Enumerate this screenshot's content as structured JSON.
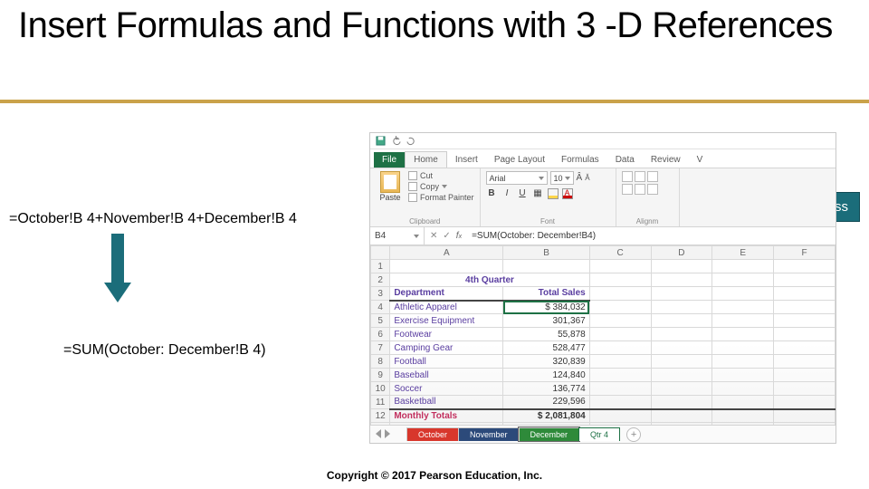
{
  "title": "Insert Formulas and Functions with 3 -D References",
  "left": {
    "formula_long": "=October!B 4+November!B 4+December!B 4",
    "formula_short": "=SUM(October: December!B 4)"
  },
  "callout": {
    "label": "Cell address"
  },
  "excel": {
    "ribbon": {
      "tabs": [
        "File",
        "Home",
        "Insert",
        "Page Layout",
        "Formulas",
        "Data",
        "Review",
        "V"
      ],
      "clipboard": {
        "paste": "Paste",
        "cut": "Cut",
        "copy": "Copy",
        "painter": "Format Painter",
        "group": "Clipboard"
      },
      "font": {
        "name": "Arial",
        "size": "10",
        "group": "Font"
      },
      "align": {
        "group": "Alignm"
      }
    },
    "namebox": "B4",
    "fx": "=SUM(October: December!B4)",
    "columns": [
      "A",
      "B",
      "C",
      "D",
      "E",
      "F"
    ],
    "header_title": "4th Quarter",
    "col_headers": {
      "dept": "Department",
      "sales": "Total Sales"
    },
    "rows": [
      {
        "n": 4,
        "dept": "Athletic Apparel",
        "val": "$   384,032"
      },
      {
        "n": 5,
        "dept": "Exercise Equipment",
        "val": "301,367"
      },
      {
        "n": 6,
        "dept": "Footwear",
        "val": "55,878"
      },
      {
        "n": 7,
        "dept": "Camping Gear",
        "val": "528,477"
      },
      {
        "n": 8,
        "dept": "Football",
        "val": "320,839"
      },
      {
        "n": 9,
        "dept": "Baseball",
        "val": "124,840"
      },
      {
        "n": 10,
        "dept": "Soccer",
        "val": "136,774"
      },
      {
        "n": 11,
        "dept": "Basketball",
        "val": "229,596"
      }
    ],
    "pre_rows": [
      1,
      2,
      3
    ],
    "totals": {
      "n": 12,
      "label": "Monthly Totals",
      "val": "$ 2,081,804"
    },
    "sheets": [
      "October",
      "November",
      "December",
      "Qtr 4"
    ]
  },
  "copyright": "Copyright © 2017 Pearson Education, Inc."
}
